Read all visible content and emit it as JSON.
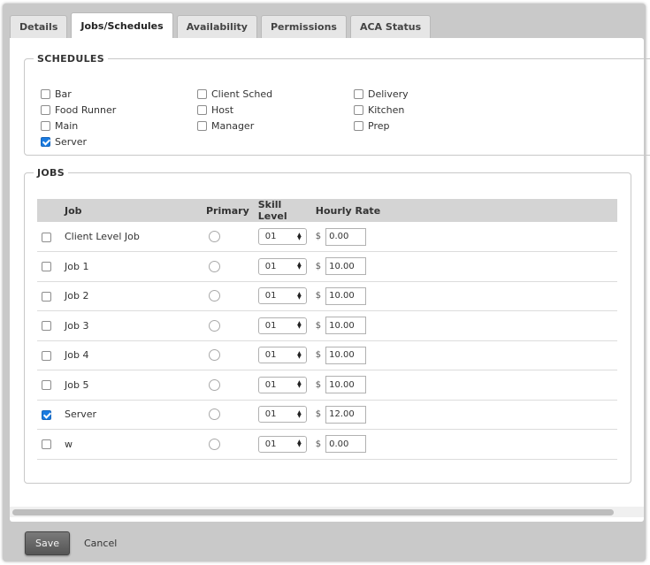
{
  "tabs": [
    {
      "label": "Details",
      "active": false
    },
    {
      "label": "Jobs/Schedules",
      "active": true
    },
    {
      "label": "Availability",
      "active": false
    },
    {
      "label": "Permissions",
      "active": false
    },
    {
      "label": "ACA Status",
      "active": false
    }
  ],
  "schedules": {
    "title": "SCHEDULES",
    "items": [
      {
        "label": "Bar",
        "checked": false
      },
      {
        "label": "Client Sched",
        "checked": false
      },
      {
        "label": "Delivery",
        "checked": false
      },
      {
        "label": "Food Runner",
        "checked": false
      },
      {
        "label": "Host",
        "checked": false
      },
      {
        "label": "Kitchen",
        "checked": false
      },
      {
        "label": "Main",
        "checked": false
      },
      {
        "label": "Manager",
        "checked": false
      },
      {
        "label": "Prep",
        "checked": false
      },
      {
        "label": "Server",
        "checked": true
      }
    ]
  },
  "jobs": {
    "title": "JOBS",
    "columns": {
      "job": "Job",
      "primary": "Primary",
      "skill": "Skill Level",
      "rate": "Hourly Rate"
    },
    "currency": "$",
    "rows": [
      {
        "job": "Client Level Job",
        "checked": false,
        "skill": "01",
        "rate": "0.00"
      },
      {
        "job": "Job 1",
        "checked": false,
        "skill": "01",
        "rate": "10.00"
      },
      {
        "job": "Job 2",
        "checked": false,
        "skill": "01",
        "rate": "10.00"
      },
      {
        "job": "Job 3",
        "checked": false,
        "skill": "01",
        "rate": "10.00"
      },
      {
        "job": "Job 4",
        "checked": false,
        "skill": "01",
        "rate": "10.00"
      },
      {
        "job": "Job 5",
        "checked": false,
        "skill": "01",
        "rate": "10.00"
      },
      {
        "job": "Server",
        "checked": true,
        "skill": "01",
        "rate": "12.00"
      },
      {
        "job": "w",
        "checked": false,
        "skill": "01",
        "rate": "0.00"
      }
    ]
  },
  "footer": {
    "save_label": "Save",
    "cancel_label": "Cancel"
  },
  "colors": {
    "checkbox_checked": "#1a7be0",
    "header_bg": "#d4d4d4",
    "frame_bg": "#c9c9c9"
  }
}
